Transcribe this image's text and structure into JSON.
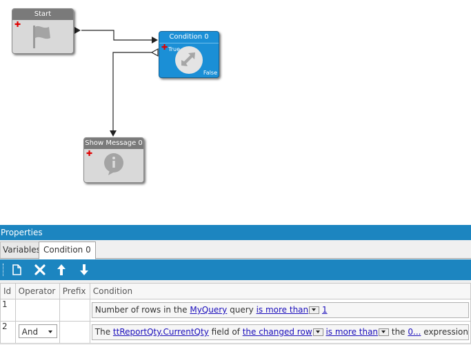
{
  "nodes": {
    "start": {
      "title": "Start"
    },
    "condition": {
      "title": "Condition 0",
      "true_label": "True",
      "false_label": "False"
    },
    "show_message": {
      "title": "Show Message 0"
    }
  },
  "properties": {
    "header": "Properties",
    "tabs": [
      "Variables",
      "Condition 0"
    ],
    "active_tab": "Condition 0",
    "toolbar_icons": [
      "new-icon",
      "delete-icon",
      "move-up-icon",
      "move-down-icon"
    ],
    "columns": [
      "Id",
      "Operator",
      "Prefix",
      "Condition"
    ],
    "rows": [
      {
        "id": "1",
        "operator": "",
        "prefix": "",
        "condition": {
          "t1": "Number of rows in the ",
          "l1": "MyQuery",
          "t2": " query ",
          "l2": "is more than",
          "l3": "1"
        }
      },
      {
        "id": "2",
        "operator": "And",
        "prefix": "",
        "condition": {
          "t1": "The ",
          "l1": "ttReportQty.CurrentQty",
          "t2": " field of ",
          "l2": "the changed row",
          "l3": "is more than",
          "t3": " the ",
          "l4": "0...",
          "t4": " expression"
        }
      }
    ]
  },
  "colors": {
    "accent": "#1c85c0",
    "node_blue": "#1b8fd6",
    "node_gray": "#7a7a7a",
    "link": "#1a0dbb",
    "plus": "#e00000"
  }
}
